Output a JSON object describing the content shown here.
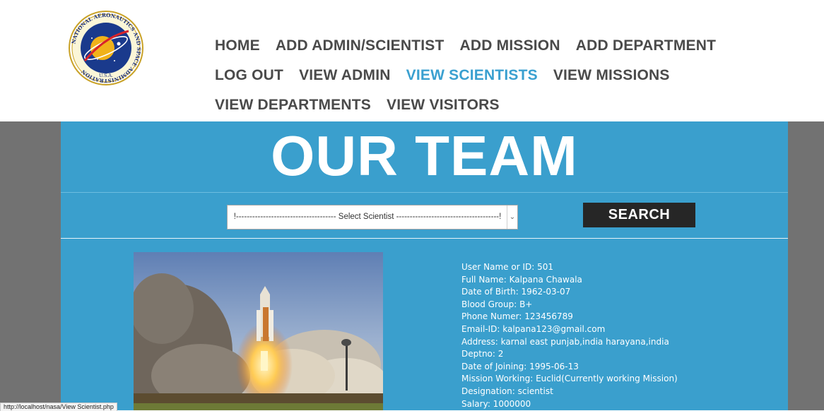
{
  "logo": {
    "ring_text": "NATIONAL AERONAUTICS AND SPACE ADMINISTRATION",
    "bottom_text": "U.S.A."
  },
  "nav": {
    "row1": [
      "HOME",
      "ADD ADMIN/SCIENTIST",
      "ADD MISSION",
      "ADD DEPARTMENT"
    ],
    "row2": [
      "LOG OUT",
      "VIEW ADMIN",
      "VIEW SCIENTISTS",
      "VIEW MISSIONS"
    ],
    "row3": [
      "VIEW DEPARTMENTS",
      "VIEW VISITORS"
    ],
    "active": "VIEW SCIENTISTS"
  },
  "main": {
    "title": "OUR TEAM",
    "select_value": "!------------------------------------- Select Scientist --------------------------------------!",
    "search_label": "SEARCH"
  },
  "details": [
    "User Name or ID: 501",
    "Full Name: Kalpana Chawala",
    "Date of Birth: 1962-03-07",
    "Blood Group: B+",
    "Phone Numer: 123456789",
    "Email-ID: kalpana123@gmail.com",
    "Address: karnal east punjab,india harayana,india",
    "Deptno: 2",
    "Date of Joining: 1995-06-13",
    "Mission Working: Euclid(Currently working Mission)",
    "Designation: scientist",
    "Salary: 1000000"
  ],
  "status_url": "http://localhost/nasa/View Scientist.php",
  "colors": {
    "accent": "#3aa0d0",
    "panel": "#3a9fcd",
    "nav_text": "#4a4a4a",
    "side_band": "#727272",
    "button": "#262626"
  }
}
